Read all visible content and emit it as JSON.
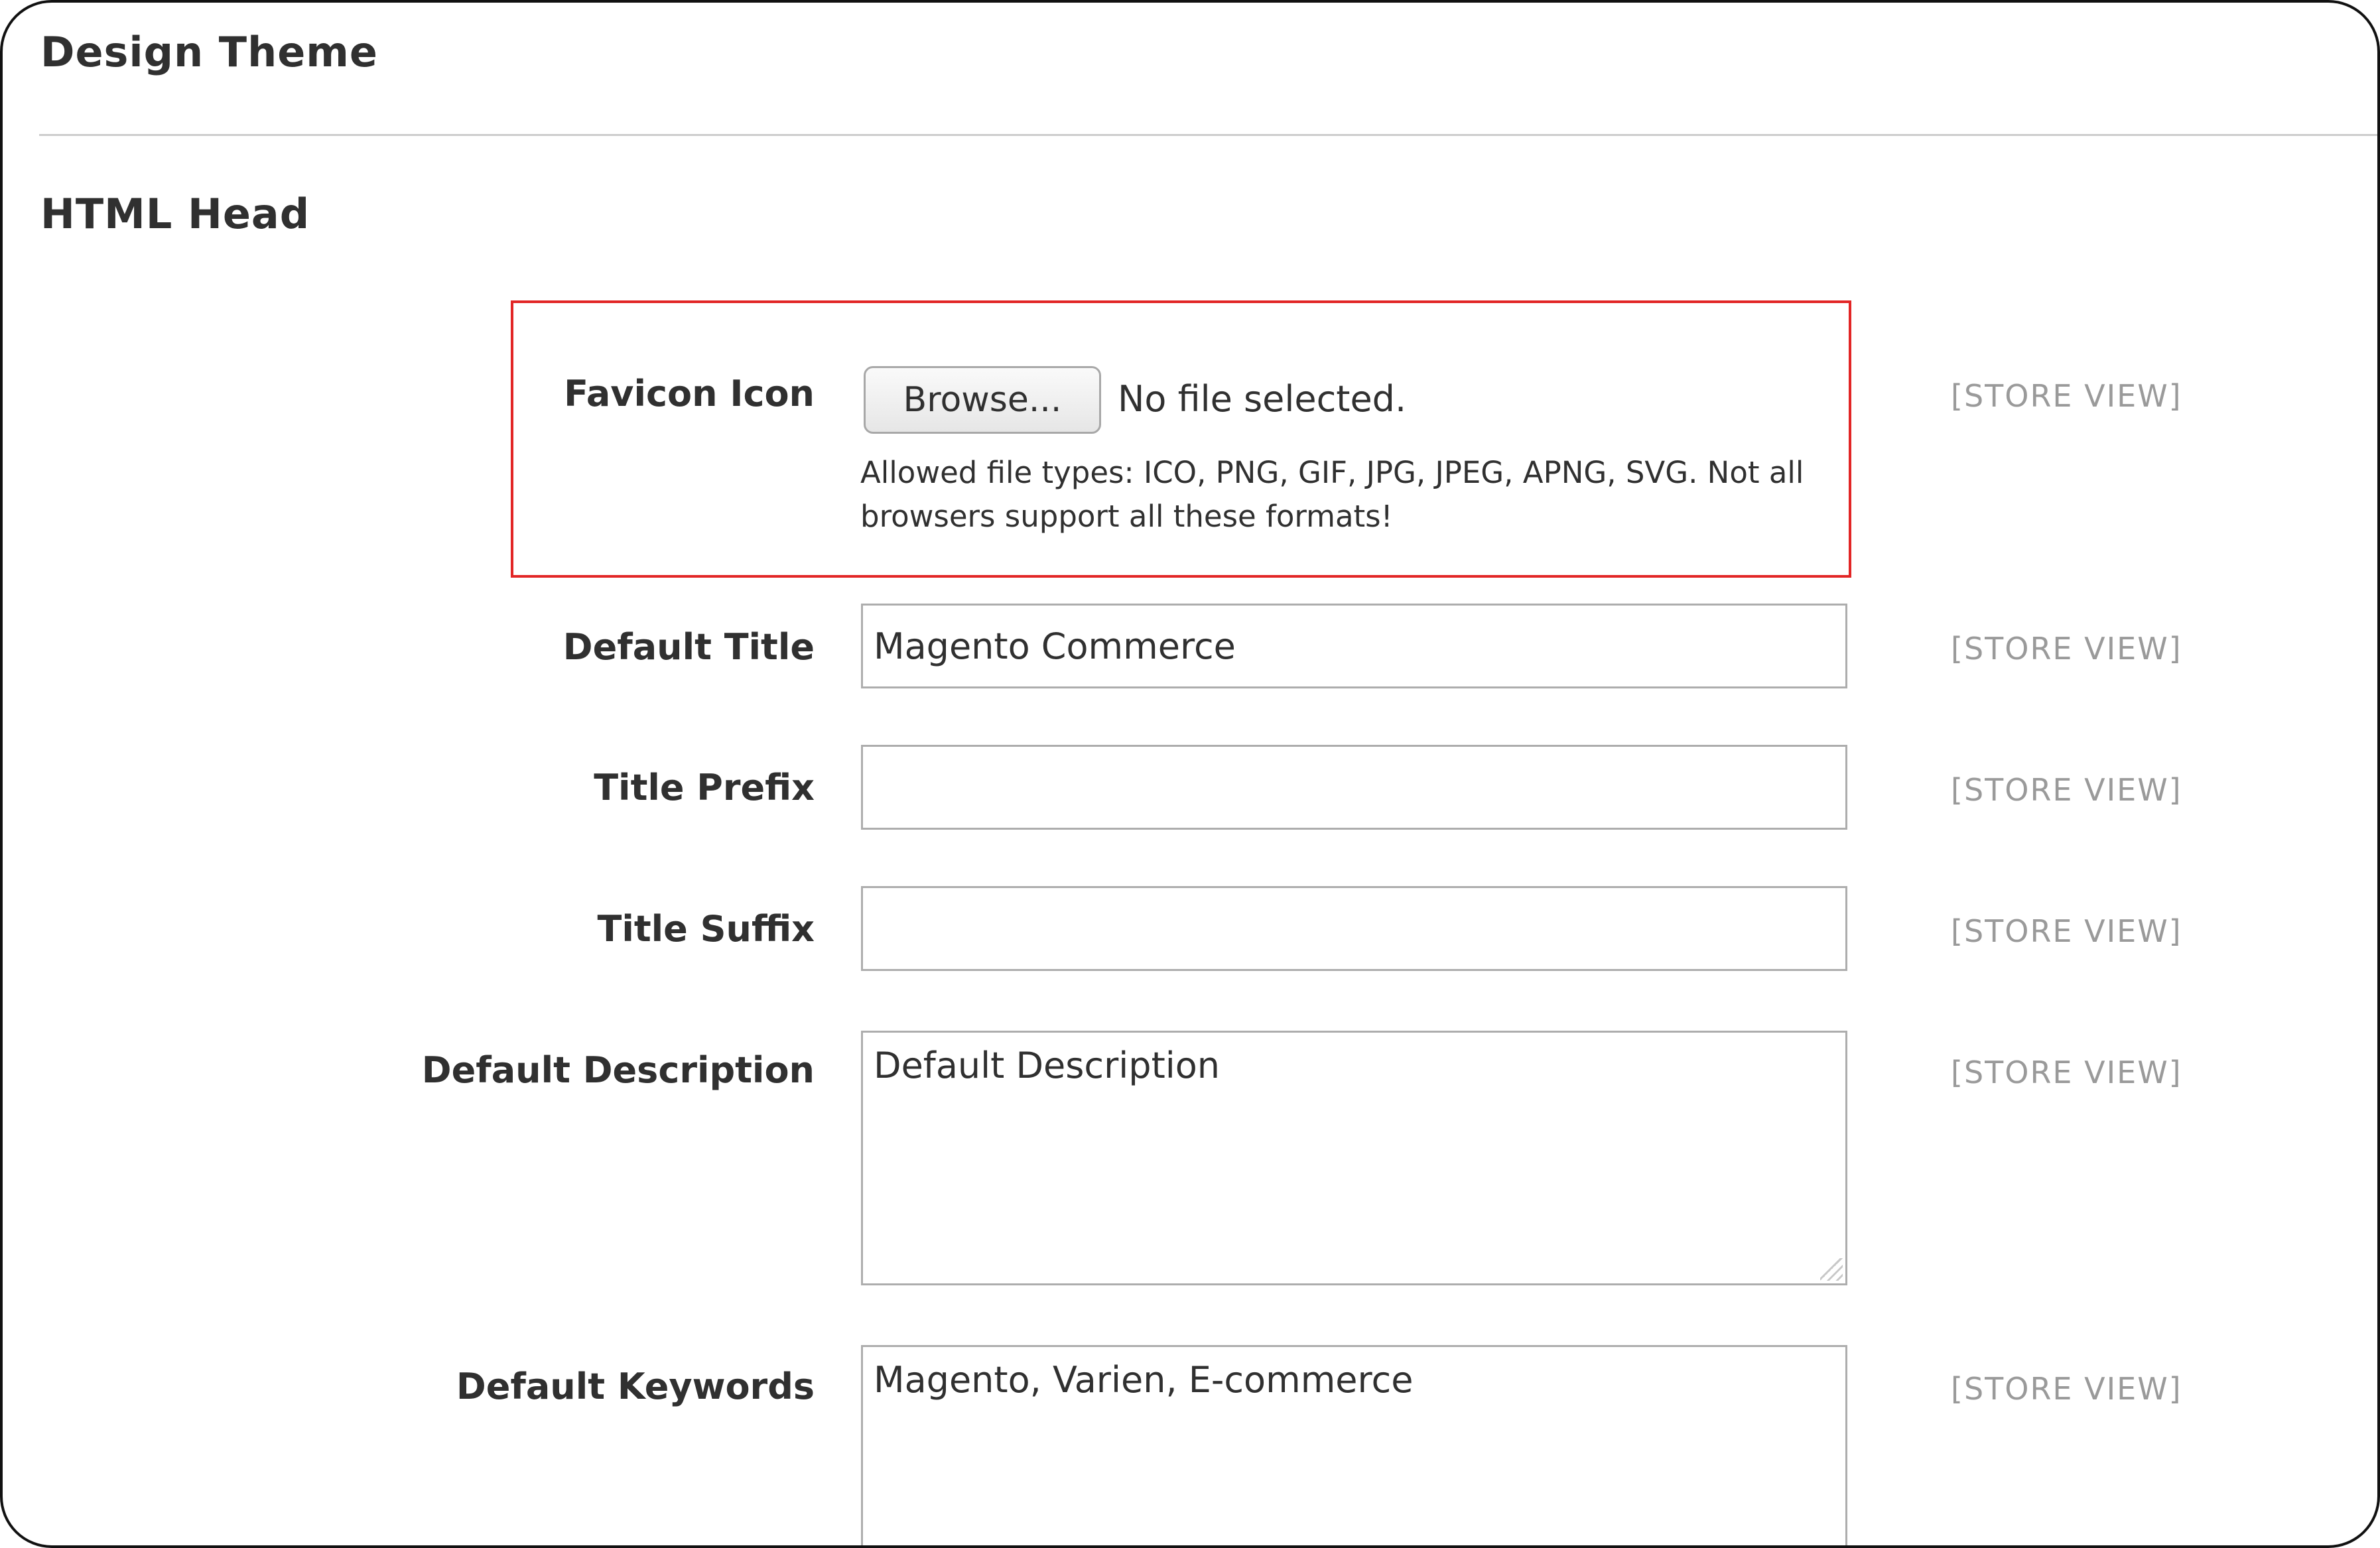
{
  "section": {
    "title": "Design Theme"
  },
  "group": {
    "title": "HTML Head"
  },
  "favicon": {
    "label": "Favicon Icon",
    "browse_label": "Browse...",
    "file_status": "No file selected.",
    "note": "Allowed file types: ICO, PNG, GIF, JPG, JPEG, APNG, SVG. Not all browsers support all these formats!",
    "scope": "[STORE VIEW]"
  },
  "default_title": {
    "label": "Default Title",
    "value": "Magento Commerce",
    "scope": "[STORE VIEW]"
  },
  "title_prefix": {
    "label": "Title Prefix",
    "value": "",
    "scope": "[STORE VIEW]"
  },
  "title_suffix": {
    "label": "Title Suffix",
    "value": "",
    "scope": "[STORE VIEW]"
  },
  "default_description": {
    "label": "Default Description",
    "value": "Default Description",
    "scope": "[STORE VIEW]"
  },
  "default_keywords": {
    "label": "Default Keywords",
    "value": "Magento, Varien, E-commerce",
    "scope": "[STORE VIEW]"
  },
  "colors": {
    "highlight_border": "#e22626",
    "scope_text": "#9a9a9a",
    "field_border": "#adadad"
  }
}
